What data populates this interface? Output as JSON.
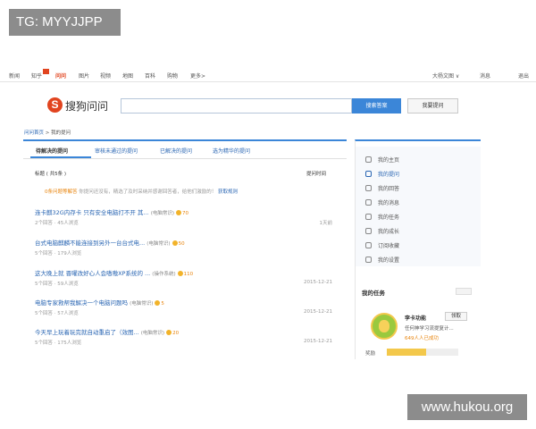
{
  "watermarks": {
    "top_left": "TG: MYYJJPP",
    "bottom_right": "www.hukou.org"
  },
  "topnav": {
    "items": [
      "新闻",
      "知乎",
      "问问",
      "图片",
      "视频",
      "地图",
      "百科",
      "购物",
      "更多>"
    ],
    "right_items": [
      "大杨文图 ∨",
      "消息",
      "退出"
    ]
  },
  "logo": {
    "mark": "S",
    "text": "搜狗问问"
  },
  "search": {
    "placeholder": "",
    "button": "搜索答案",
    "ask_button": "我要提问"
  },
  "breadcrumb": {
    "home": "问问首页",
    "sep": ">",
    "current": "我的提问"
  },
  "tabs": [
    "待解决的提问",
    "审核未通过的提问",
    "已解决的提问",
    "选为精华的提问"
  ],
  "columns": {
    "title": "标题 ( 共5条 )",
    "time": "提问时间"
  },
  "notice": {
    "highlight": "0条问题等解答",
    "text": "  你提问还没有，精选了及时采纳并感谢回答者，给他们激励的！",
    "link": "获取规则"
  },
  "questions": [
    {
      "title": "连卡麒32G内存卡 只有安全电脑打不开 其...",
      "tag": "(电脑常识)",
      "reward": "70",
      "meta": "2个回答 · 45人浏览",
      "time": "1天前"
    },
    {
      "title": "台式电脑麒麟不能连接到另外一台台式电...",
      "tag": "(电脑常识)",
      "reward": "50",
      "meta": "5个回答 · 179人浏览",
      "time": "1天前"
    },
    {
      "title": "这大晚上就 晋曜改好心人会嗷嗷XP系统的 ...",
      "tag": "(操作系统)",
      "reward": "110",
      "meta": "5个回答 · 59人浏览",
      "time": "2015-12-21"
    },
    {
      "title": "电脑专家救帮我解决一个电脑问题吗",
      "tag": "(电脑常识)",
      "reward": "5",
      "meta": "5个回答 · 57人浏览",
      "time": "2015-12-21"
    },
    {
      "title": "今天早上玩着玩完就自动重启了（效图...",
      "tag": "(电脑常识)",
      "reward": "20",
      "meta": "5个回答 · 175人浏览",
      "time": "2015-12-21"
    }
  ],
  "sidebar": {
    "items": [
      "我的主页",
      "我的提问",
      "我的回答",
      "我的消息",
      "我的任务",
      "我的成长",
      "订阅收藏",
      "我的设置"
    ],
    "active_index": 1
  },
  "task": {
    "title": "我的任务",
    "name": "李卡功能",
    "button": "领取",
    "desc": "任何神学习流提复计...",
    "stat": "649人人已成功",
    "reward_label": "奖励",
    "progress": 0.55
  },
  "colors": {
    "accent": "#3b86d8",
    "brand": "#e1441f",
    "link": "#2a66b3",
    "reward": "#e8850f"
  }
}
